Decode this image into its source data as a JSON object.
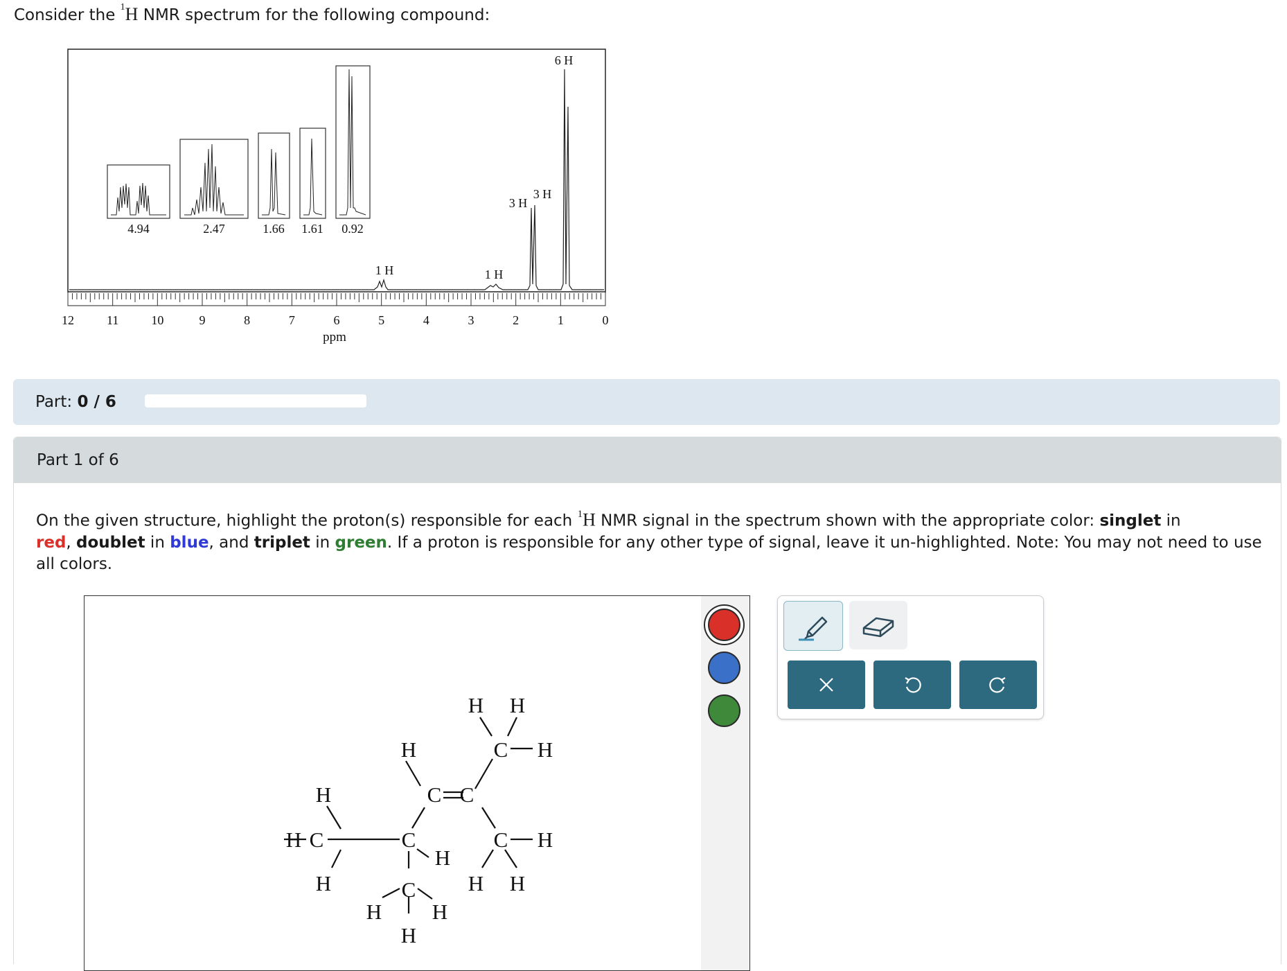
{
  "question": {
    "intro_before": "Consider the ",
    "intro_sup": "1",
    "intro_H": "H",
    "intro_after": " NMR spectrum for the following compound:"
  },
  "spectrum": {
    "x_axis_label": "ppm",
    "ticks": [
      "12",
      "11",
      "10",
      "9",
      "8",
      "7",
      "6",
      "5",
      "4",
      "3",
      "2",
      "1",
      "0"
    ],
    "integrations": [
      "6 H",
      "3 H",
      "3 H",
      "1 H",
      "1 H"
    ],
    "inset_labels": [
      "4.94",
      "2.47",
      "1.66",
      "1.61",
      "0.92"
    ]
  },
  "part_bar": {
    "label": "Part:",
    "progress": "0 / 6",
    "progress_fraction": 0
  },
  "part": {
    "title": "Part 1 of 6",
    "instr_1": "On the given structure, highlight the proton(s) responsible for each ",
    "instr_sup": "1",
    "instr_H": "H",
    "instr_2": " NMR signal in the spectrum shown with the appropriate color: ",
    "singlet": "singlet",
    "in_1": " in",
    "red": "red",
    "comma_1": ", ",
    "doublet": "doublet",
    "in_2": " in ",
    "blue": "blue",
    "and": ", and ",
    "triplet": "triplet",
    "in_3": " in ",
    "green": "green",
    "instr_3": ". If a proton is responsible for any other type of signal, leave it un-highlighted. Note: You may not need to use all colors."
  },
  "structure": {
    "atoms": {
      "H": "H",
      "C": "C"
    }
  },
  "palette": {
    "colors": {
      "red": "#d9302a",
      "blue": "#3a70c8",
      "green": "#3e8a3a"
    },
    "selected": "red"
  },
  "toolbox": {
    "tools": [
      "highlighter-icon",
      "eraser-icon"
    ],
    "actions": [
      "close-icon",
      "undo-icon",
      "redo-icon"
    ]
  }
}
